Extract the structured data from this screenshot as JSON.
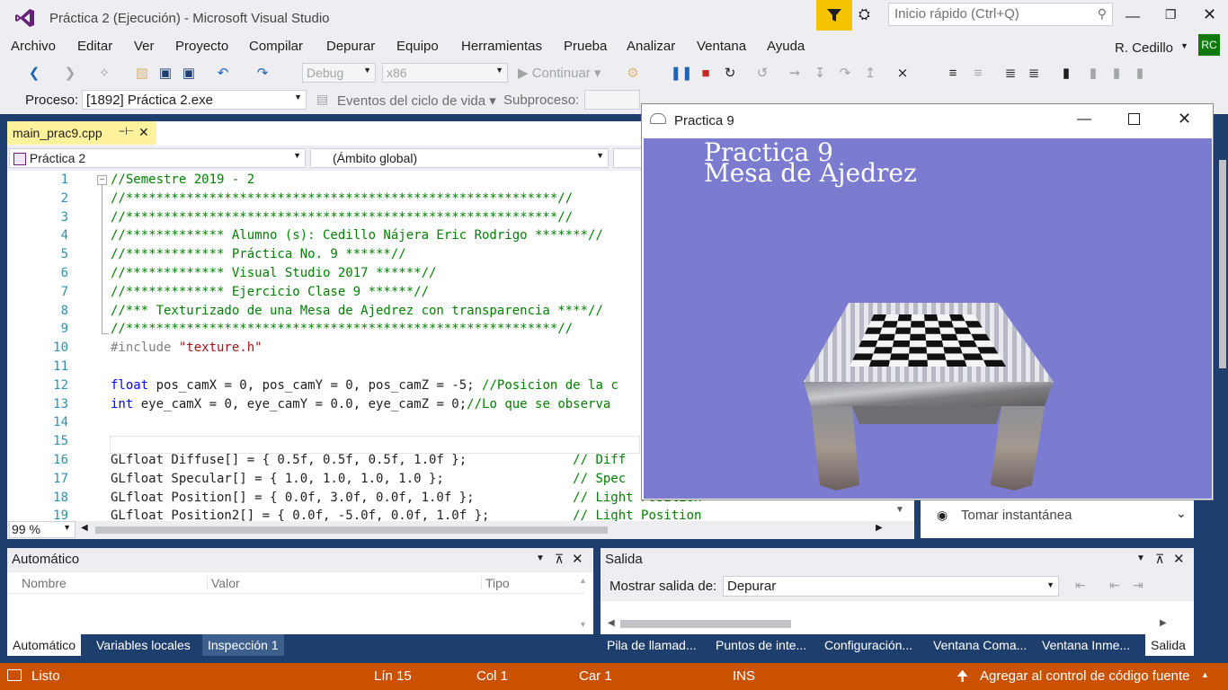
{
  "window": {
    "title": "Práctica 2 (Ejecución) - Microsoft Visual Studio",
    "quick_launch": "Inicio rápido (Ctrl+Q)",
    "user": "R. Cedillo",
    "user_initials": "RC"
  },
  "menu": [
    "Archivo",
    "Editar",
    "Ver",
    "Proyecto",
    "Compilar",
    "Depurar",
    "Equipo",
    "Herramientas",
    "Prueba",
    "Analizar",
    "Ventana",
    "Ayuda"
  ],
  "toolbar": {
    "config": "Debug",
    "platform": "x86",
    "continue": "Continuar"
  },
  "debugbar": {
    "process_label": "Proceso:",
    "process_value": "[1892] Práctica 2.exe",
    "lifecycle": "Eventos del ciclo de vida",
    "thread_label": "Subproceso:"
  },
  "editor": {
    "tab": "main_prac9.cpp",
    "project_combo": "Práctica 2",
    "scope_combo": "(Ámbito global)",
    "zoom": "99 %"
  },
  "code": [
    {
      "n": "1",
      "parts": [
        [
          "cm",
          "//Semestre 2019 - 2"
        ]
      ]
    },
    {
      "n": "2",
      "parts": [
        [
          "cm",
          "//*********************************************************//"
        ]
      ]
    },
    {
      "n": "3",
      "parts": [
        [
          "cm",
          "//*********************************************************//"
        ]
      ]
    },
    {
      "n": "4",
      "parts": [
        [
          "cm",
          "//************* Alumno (s): Cedillo Nájera Eric Rodrigo *******//"
        ]
      ]
    },
    {
      "n": "5",
      "parts": [
        [
          "cm",
          "//************* Práctica No. 9 ******//"
        ]
      ]
    },
    {
      "n": "6",
      "parts": [
        [
          "cm",
          "//************* Visual Studio 2017 ******//"
        ]
      ]
    },
    {
      "n": "7",
      "parts": [
        [
          "cm",
          "//************* Ejercicio Clase 9 ******//"
        ]
      ]
    },
    {
      "n": "8",
      "parts": [
        [
          "cm",
          "//*** Texturizado de una Mesa de Ajedrez con transparencia ****//"
        ]
      ]
    },
    {
      "n": "9",
      "parts": [
        [
          "cm",
          "//*********************************************************//"
        ]
      ]
    },
    {
      "n": "10",
      "parts": [
        [
          "pp",
          "#include "
        ],
        [
          "st",
          "\"texture.h\""
        ]
      ]
    },
    {
      "n": "11",
      "parts": []
    },
    {
      "n": "12",
      "parts": [
        [
          "kw",
          "float"
        ],
        [
          "",
          "pos_camX = 0, pos_camY = 0, pos_camZ = -5; "
        ],
        [
          "cm",
          "//Posicion de la c"
        ]
      ]
    },
    {
      "n": "13",
      "parts": [
        [
          "kw",
          "int"
        ],
        [
          "",
          "eye_camX = 0, eye_camY = 0.0, eye_camZ = 0;"
        ],
        [
          "cm",
          "//Lo que se observa"
        ]
      ]
    },
    {
      "n": "14",
      "parts": []
    },
    {
      "n": "15",
      "parts": []
    },
    {
      "n": "16",
      "parts": [
        [
          "",
          "GLfloat Diffuse[] = { 0.5f, 0.5f, 0.5f, 1.0f };              "
        ],
        [
          "cm",
          "// Diff"
        ]
      ]
    },
    {
      "n": "17",
      "parts": [
        [
          "",
          "GLfloat Specular[] = { 1.0, 1.0, 1.0, 1.0 };                 "
        ],
        [
          "cm",
          "// Spec"
        ]
      ]
    },
    {
      "n": "18",
      "parts": [
        [
          "",
          "GLfloat Position[] = { 0.0f, 3.0f, 0.0f, 1.0f };             "
        ],
        [
          "cm",
          "// Light Position"
        ]
      ]
    },
    {
      "n": "19",
      "parts": [
        [
          "",
          "GLfloat Position2[] = { 0.0f, -5.0f, 0.0f, 1.0f };           "
        ],
        [
          "cm",
          "// Light Position"
        ]
      ]
    }
  ],
  "glwindow": {
    "title": "Practica 9",
    "heading1": "Practica 9",
    "heading2": "Mesa de Ajedrez"
  },
  "snapshot": "Tomar instantánea",
  "auto_panel": {
    "title": "Automático",
    "cols": [
      "Nombre",
      "Valor",
      "Tipo"
    ]
  },
  "output_panel": {
    "title": "Salida",
    "show_label": "Mostrar salida de:",
    "show_value": "Depurar"
  },
  "left_tabs": [
    "Automático",
    "Variables locales",
    "Inspección 1"
  ],
  "right_tabs": [
    "Pila de llamad...",
    "Puntos de inte...",
    "Configuración...",
    "Ventana Coma...",
    "Ventana Inme...",
    "Salida"
  ],
  "status": {
    "state": "Listo",
    "line": "Lín 15",
    "col": "Col 1",
    "car": "Car 1",
    "mode": "INS",
    "source": "Agregar al control de código fuente"
  }
}
